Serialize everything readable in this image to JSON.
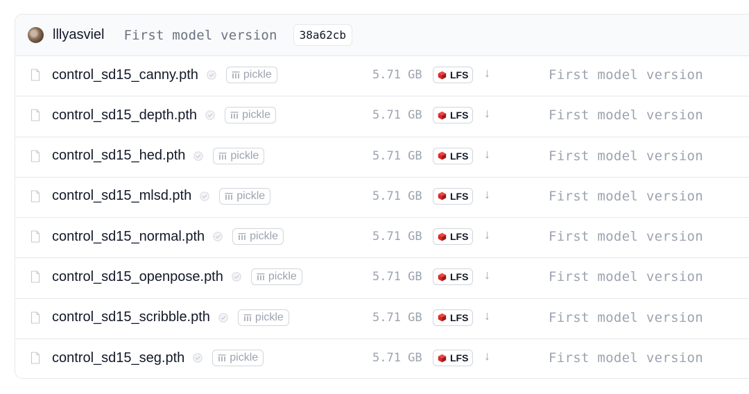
{
  "header": {
    "author": "lllyasviel",
    "commit_message": "First model version",
    "commit_sha": "38a62cb"
  },
  "files": [
    {
      "name": "control_sd15_canny.pth",
      "badge": "pickle",
      "size": "5.71 GB",
      "lfs": "LFS",
      "commit": "First model version"
    },
    {
      "name": "control_sd15_depth.pth",
      "badge": "pickle",
      "size": "5.71 GB",
      "lfs": "LFS",
      "commit": "First model version"
    },
    {
      "name": "control_sd15_hed.pth",
      "badge": "pickle",
      "size": "5.71 GB",
      "lfs": "LFS",
      "commit": "First model version"
    },
    {
      "name": "control_sd15_mlsd.pth",
      "badge": "pickle",
      "size": "5.71 GB",
      "lfs": "LFS",
      "commit": "First model version"
    },
    {
      "name": "control_sd15_normal.pth",
      "badge": "pickle",
      "size": "5.71 GB",
      "lfs": "LFS",
      "commit": "First model version"
    },
    {
      "name": "control_sd15_openpose.pth",
      "badge": "pickle",
      "size": "5.71 GB",
      "lfs": "LFS",
      "commit": "First model version"
    },
    {
      "name": "control_sd15_scribble.pth",
      "badge": "pickle",
      "size": "5.71 GB",
      "lfs": "LFS",
      "commit": "First model version"
    },
    {
      "name": "control_sd15_seg.pth",
      "badge": "pickle",
      "size": "5.71 GB",
      "lfs": "LFS",
      "commit": "First model version"
    }
  ],
  "colors": {
    "lfs_icon": "#dc2626",
    "muted_text": "#9ca3af",
    "border": "#e5e7eb"
  },
  "icons": {
    "file": "file-icon",
    "security": "shield-check-icon",
    "pickle": "pickle-icon",
    "lfs": "lfs-cube-icon",
    "download": "download-arrow-icon"
  }
}
